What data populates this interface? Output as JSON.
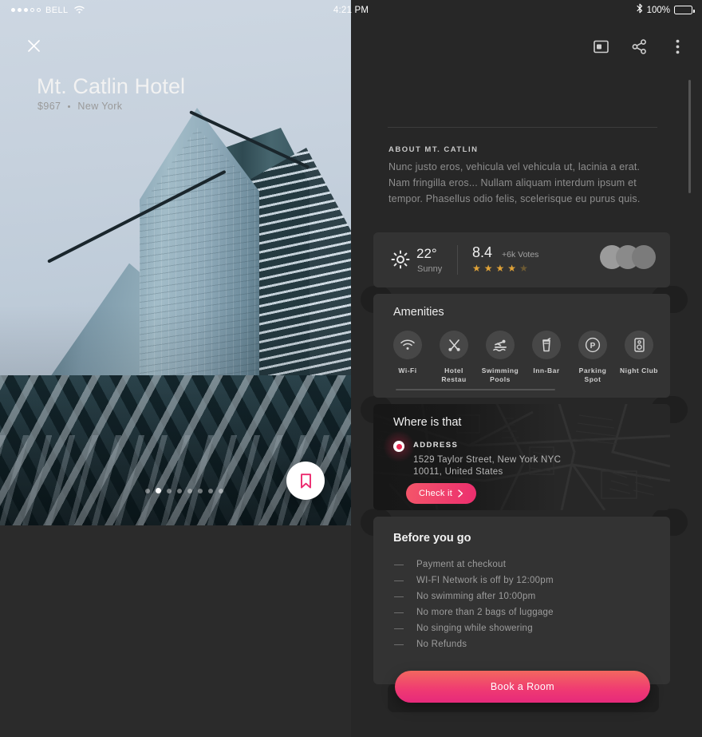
{
  "statusbar": {
    "carrier": "BELL",
    "signal_dots_filled": 3,
    "signal_dots_total": 5,
    "wifi_icon": "wifi-icon",
    "time": "4:21 PM",
    "bluetooth_icon": "bluetooth-icon",
    "battery_percent": "100%"
  },
  "photo": {
    "close_icon": "close-icon",
    "bookmark_icon": "bookmark-icon",
    "pagination_total": 8,
    "pagination_active_index": 1
  },
  "topbar": {
    "card_icon": "card-view-icon",
    "share_icon": "share-icon",
    "more_icon": "more-vertical-icon"
  },
  "hotel": {
    "title": "Mt. Catlin Hotel",
    "price": "$967",
    "location": "New York",
    "about_label": "ABOUT MT. CATLIN",
    "about_body": "Nunc justo eros, vehicula vel vehicula ut, lacinia a erat. Nam fringilla eros... Nullam aliquam interdum ipsum et tempor. Phasellus odio felis, scelerisque eu purus quis."
  },
  "meta": {
    "weather_icon": "sun-icon",
    "temperature": "22°",
    "condition": "Sunny",
    "score": "8.4",
    "votes": "+6k Votes",
    "stars_filled": 4,
    "stars_total": 5,
    "star_color": "#e0a338",
    "avatars_count": 3
  },
  "amenities": {
    "title": "Amenities",
    "items": [
      {
        "label": "Wi-Fi",
        "icon": "wifi-icon"
      },
      {
        "label": "Hotel Restau",
        "icon": "cutlery-icon"
      },
      {
        "label": "Swimming Pools",
        "icon": "swimmer-icon"
      },
      {
        "label": "Inn-Bar",
        "icon": "drink-cup-icon"
      },
      {
        "label": "Parking Spot",
        "icon": "parking-icon"
      },
      {
        "label": "Night Club",
        "icon": "speaker-icon"
      }
    ]
  },
  "map": {
    "title": "Where is that",
    "pin_icon": "map-pin-icon",
    "address_label": "ADDRESS",
    "address_line1": "1529 Taylor Street, New York NYC",
    "address_line2": "10011, United States",
    "check_button": "Check it",
    "check_button_icon": "chevron-right-icon"
  },
  "before": {
    "title": "Before you go",
    "items": [
      "Payment at checkout",
      "WI-FI Network is off by 12:00pm",
      "No swimming after 10:00pm",
      "No more than 2 bags of luggage",
      "No singing while showering",
      "No Refunds"
    ]
  },
  "cta": {
    "book_label": "Book a Room"
  },
  "colors": {
    "accent_pink": "#ec2a6e",
    "accent_coral": "#f2675f",
    "panel_bg": "#272727",
    "card_bg": "#333333",
    "star_gold": "#e0a338"
  }
}
